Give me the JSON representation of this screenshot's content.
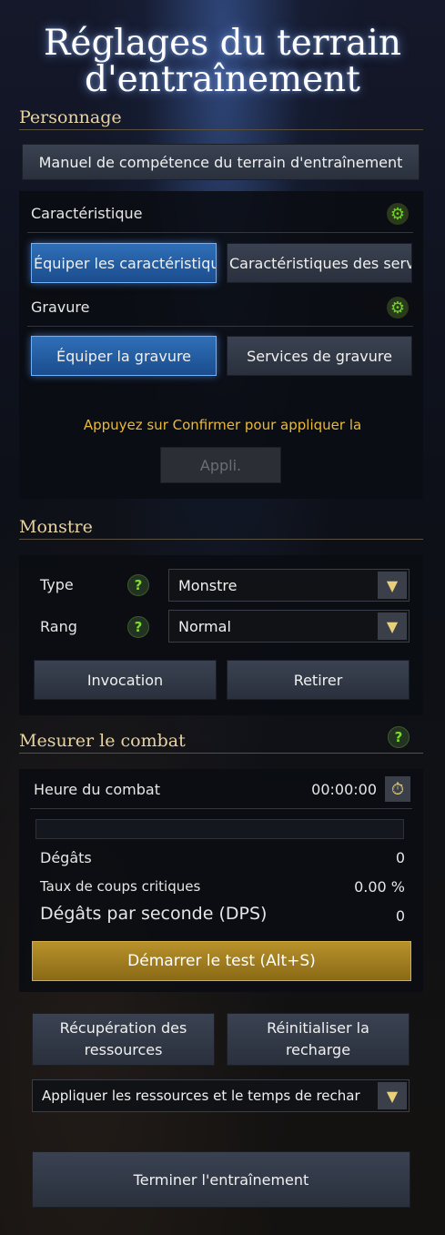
{
  "title": "Réglages du terrain d'entraînement",
  "personnage": {
    "heading": "Personnage",
    "manual_button": "Manuel de compétence du terrain d'entraînement",
    "characteristic_label": "Caractéristique",
    "equip_characteristics": "Équiper les caractéristiques",
    "characteristic_services": "Caractéristiques des services",
    "engraving_label": "Gravure",
    "equip_engraving": "Équiper la gravure",
    "engraving_services": "Services de gravure",
    "confirm_notice": "Appuyez sur Confirmer pour appliquer la",
    "apply_button": "Appli."
  },
  "monstre": {
    "heading": "Monstre",
    "type_label": "Type",
    "type_value": "Monstre",
    "rank_label": "Rang",
    "rank_value": "Normal",
    "summon_button": "Invocation",
    "remove_button": "Retirer"
  },
  "combat": {
    "heading": "Mesurer le combat",
    "time_label": "Heure du combat",
    "time_value": "00:00:00",
    "progress": 0,
    "damage_label": "Dégâts",
    "damage_value": "0",
    "crit_label": "Taux de coups critiques",
    "crit_value": "0.00 %",
    "dps_label": "Dégâts par seconde (DPS)",
    "dps_value": "0",
    "start_button": "Démarrer le test (Alt+S)",
    "recovery_button": "Récupération des ressources",
    "reset_cooldown_button": "Réinitialiser la recharge",
    "apply_resources_select": "Appliquer les ressources et le temps de recharge",
    "end_button": "Terminer l'entraînement"
  },
  "icons": {
    "gear": "gear-icon",
    "help": "help-icon",
    "timer": "stopwatch-icon",
    "chevron": "chevron-down-icon"
  }
}
